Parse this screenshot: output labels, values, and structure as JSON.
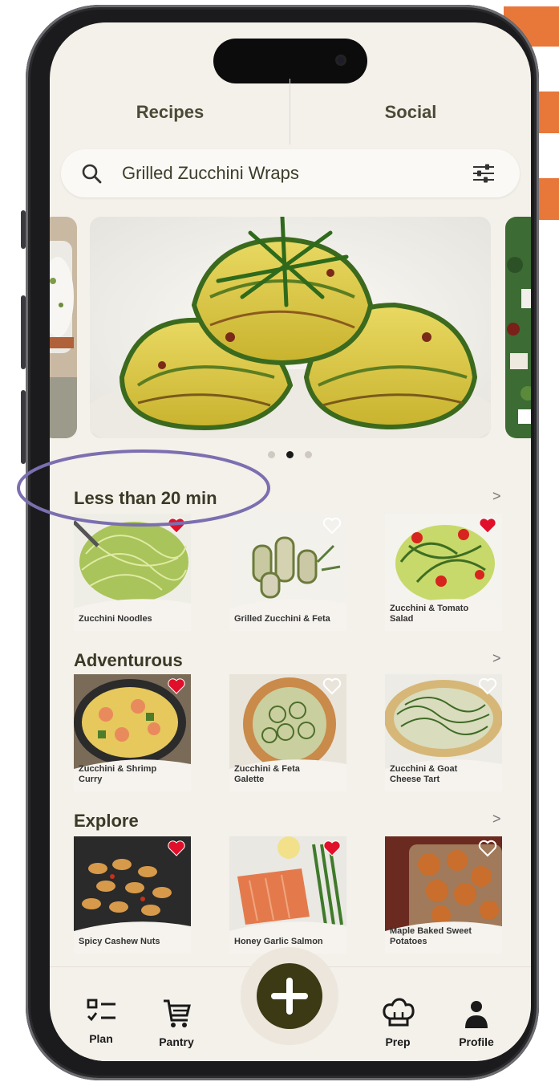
{
  "tabs": {
    "recipes": "Recipes",
    "social": "Social"
  },
  "search": {
    "query": "Grilled Zucchini Wraps",
    "icon": "search-icon",
    "filter_icon": "filter-sliders-icon"
  },
  "carousel": {
    "active_index": 1,
    "count": 3,
    "hero": "Grilled Zucchini Wraps"
  },
  "sections": [
    {
      "title": "Less than 20 min",
      "more": ">",
      "items": [
        {
          "label": "Zucchini Noodles",
          "favorite": true
        },
        {
          "label": "Grilled Zucchini & Feta",
          "favorite": false
        },
        {
          "label": "Zucchini & Tomato Salad",
          "favorite": true
        }
      ]
    },
    {
      "title": "Adventurous",
      "more": ">",
      "items": [
        {
          "label": "Zucchini & Shrimp Curry",
          "favorite": true
        },
        {
          "label": "Zucchini & Feta Galette",
          "favorite": false
        },
        {
          "label": "Zucchini & Goat Cheese Tart",
          "favorite": false
        }
      ]
    },
    {
      "title": "Explore",
      "more": ">",
      "items": [
        {
          "label": "Spicy Cashew Nuts",
          "favorite": true
        },
        {
          "label": "Honey Garlic Salmon",
          "favorite": true
        },
        {
          "label": "Maple Baked Sweet Potatoes",
          "favorite": false
        }
      ]
    }
  ],
  "nav": {
    "plan": "Plan",
    "pantry": "Pantry",
    "add": "+",
    "prep": "Prep",
    "profile": "Profile"
  },
  "colors": {
    "accent": "#3b3a14",
    "heart": "#e0102a",
    "background": "#f4f0ea",
    "annotation": "#7b6fb0",
    "orange_tab": "#e8773a"
  }
}
